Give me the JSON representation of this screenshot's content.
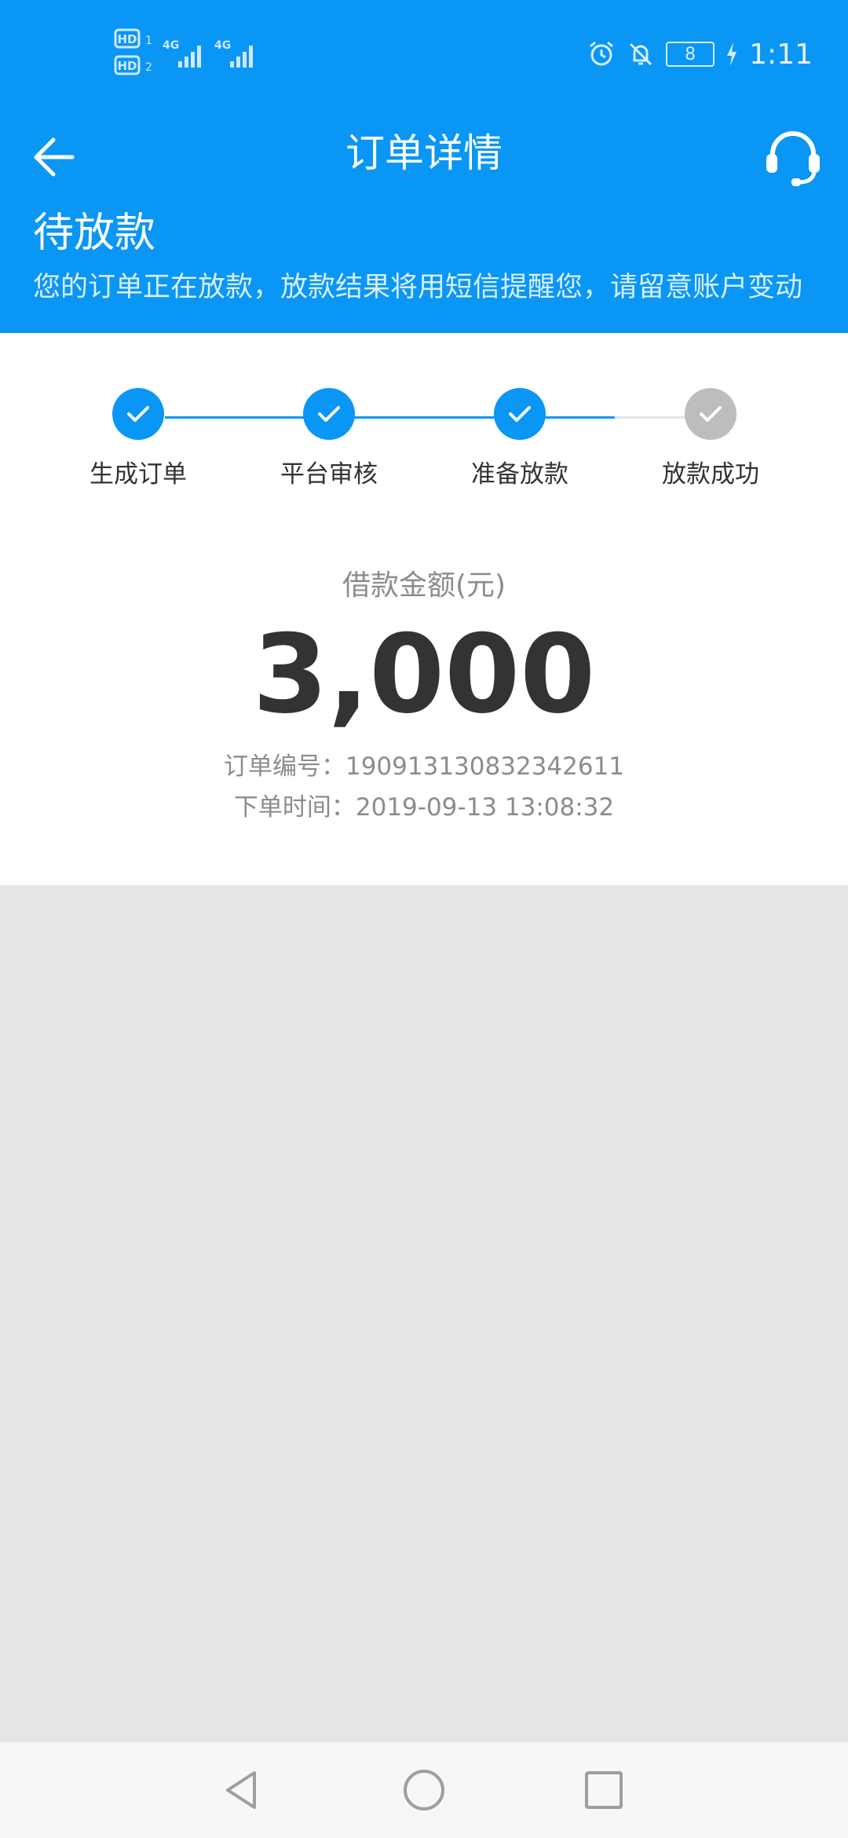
{
  "status_bar": {
    "sim1": "HD 1",
    "sim2": "HD 2",
    "network1": "4G",
    "network2": "4G",
    "battery": "8",
    "time": "1:11"
  },
  "header": {
    "title": "订单详情",
    "back_icon": "arrow-left-icon",
    "service_icon": "headset-icon"
  },
  "order_status": {
    "title": "待放款",
    "description": "您的订单正在放款，放款结果将用短信提醒您，请留意账户变动"
  },
  "steps": [
    {
      "label": "生成订单",
      "done": true
    },
    {
      "label": "平台审核",
      "done": true
    },
    {
      "label": "准备放款",
      "done": true
    },
    {
      "label": "放款成功",
      "done": false
    }
  ],
  "loan": {
    "amount_label": "借款金额(元)",
    "amount": "3,000",
    "order_no": "订单编号：190913130832342611",
    "order_time": "下单时间：2019-09-13 13:08:32"
  },
  "colors": {
    "primary": "#0a96f5",
    "inactive": "#bdbdbd",
    "background": "#e5e5e5"
  }
}
